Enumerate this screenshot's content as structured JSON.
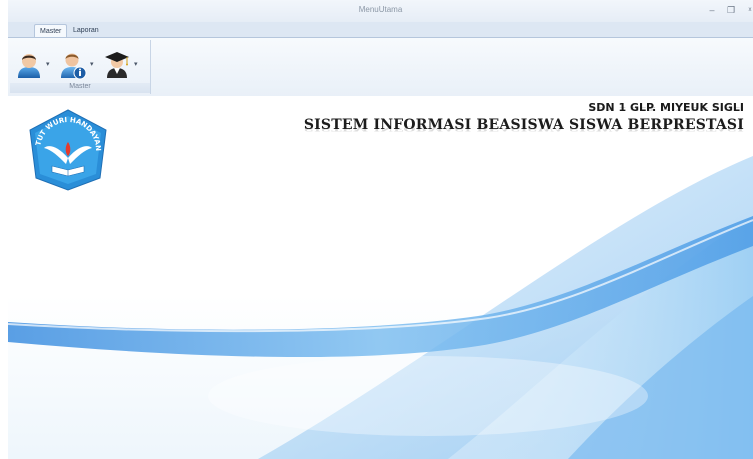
{
  "window": {
    "title": "MenuUtama",
    "minimize_icon": "–",
    "maximize_icon": "❐"
  },
  "ribbon": {
    "tabs": [
      {
        "label": "Master",
        "active": true
      },
      {
        "label": "Laporan",
        "active": false
      }
    ],
    "groups": [
      {
        "label": "Master",
        "buttons": [
          {
            "icon": "user-icon"
          },
          {
            "icon": "user-info-icon"
          },
          {
            "icon": "graduate-icon"
          }
        ]
      }
    ]
  },
  "main": {
    "school_name": "SDN 1 GLP. MIYEUK SIGLI",
    "system_title": "SISTEM INFORMASI BEASISWA SISWA BERPRESTASI",
    "logo_text": "TUT WURI HANDAYANI",
    "logo_icon": "tut-wuri-handayani-logo"
  },
  "colors": {
    "accent": "#2f7fd8",
    "wave_light": "#bfe0f7",
    "wave_dark": "#3f8fdc"
  }
}
